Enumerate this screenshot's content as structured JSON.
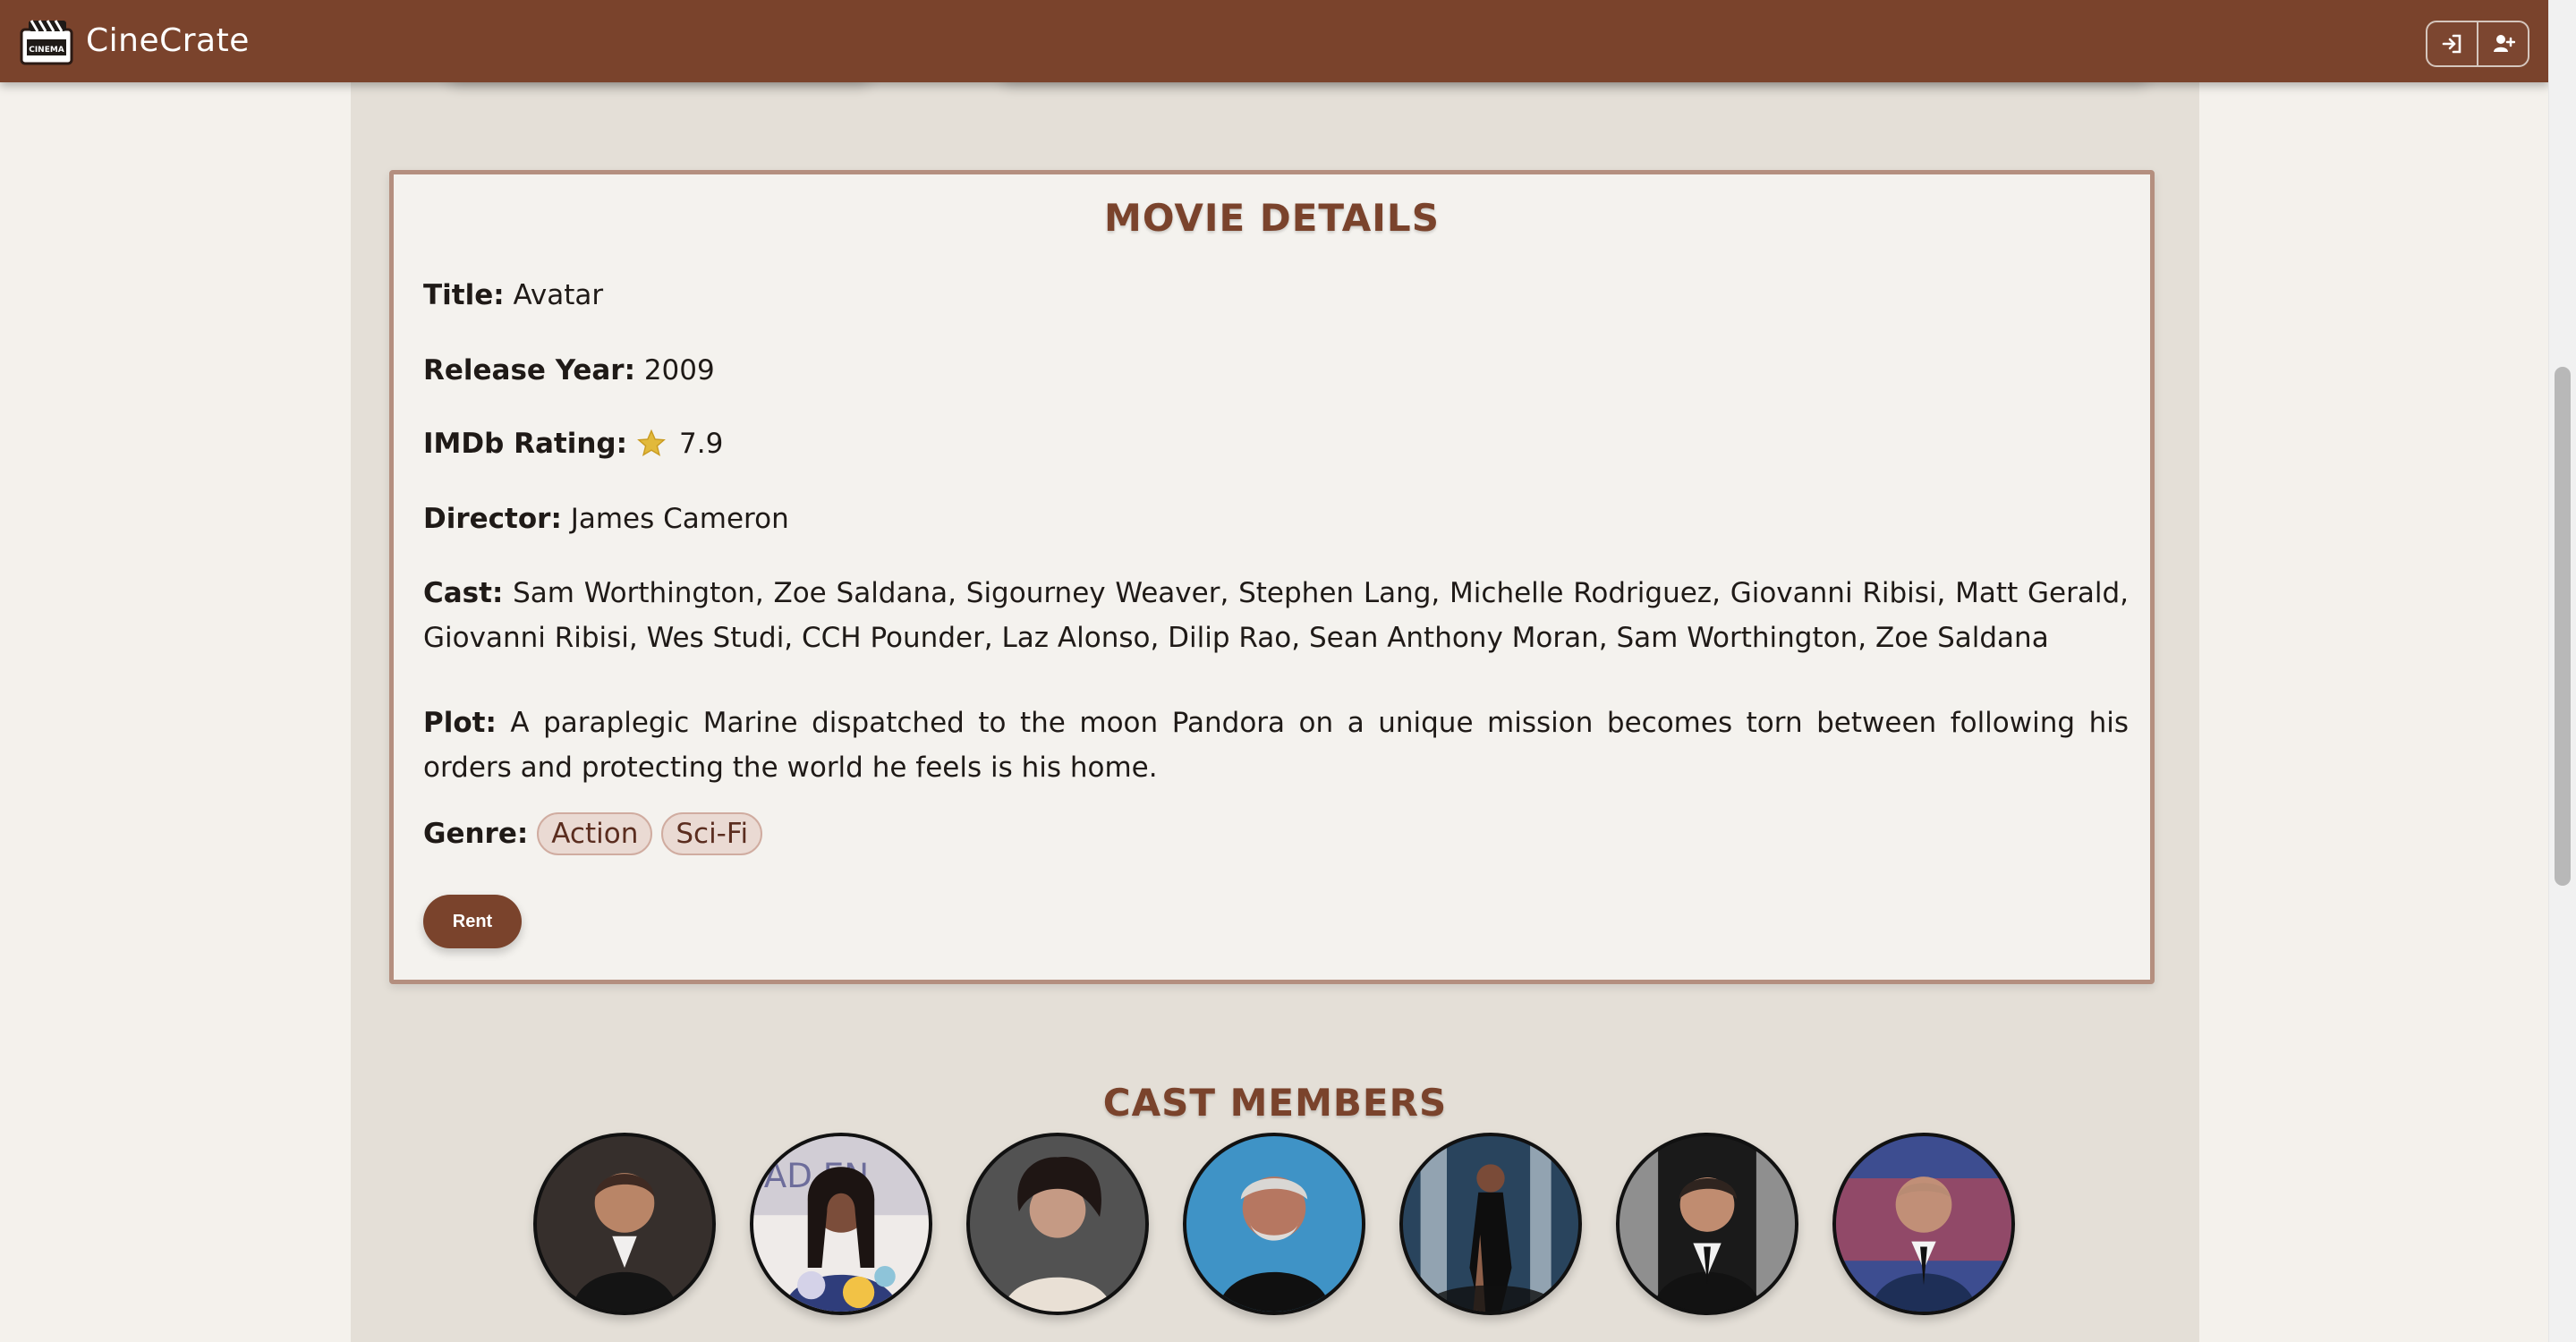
{
  "navbar": {
    "brand": "CineCrate",
    "logo_icon": "cinema-logo-icon",
    "logo_text": "CINEMA",
    "actions": [
      {
        "icon": "sign-in-icon",
        "label": ""
      },
      {
        "icon": "user-plus-icon",
        "label": ""
      }
    ]
  },
  "details": {
    "heading": "MOVIE DETAILS",
    "title_label": "Title:",
    "title": "Avatar",
    "release_year_label": "Release Year:",
    "release_year": "2009",
    "rating_label": "IMDb Rating:",
    "rating": "7.9",
    "rating_icon": "star-icon",
    "director_label": "Director:",
    "director": "James Cameron",
    "cast_label": "Cast:",
    "cast": "Sam Worthington, Zoe Saldana, Sigourney Weaver, Stephen Lang, Michelle Rodriguez, Giovanni Ribisi, Matt Gerald, Giovanni Ribisi, Wes Studi, CCH Pounder, Laz Alonso, Dilip Rao, Sean Anthony Moran, Sam Worthington, Zoe Saldana",
    "plot_label": "Plot:",
    "plot": "A paraplegic Marine dispatched to the moon Pandora on a unique mission becomes torn between following his orders and protecting the world he feels is his home.",
    "genre_label": "Genre:",
    "genres": [
      "Action",
      "Sci-Fi"
    ],
    "rent_label": "Rent"
  },
  "cast_section": {
    "heading": "CAST MEMBERS"
  },
  "colors": {
    "brand": "#7a432c",
    "page_background": "#e4dfd7",
    "card_background": "#f4f2ee",
    "card_border": "#b48f7f",
    "chip_background": "#eadad3"
  }
}
